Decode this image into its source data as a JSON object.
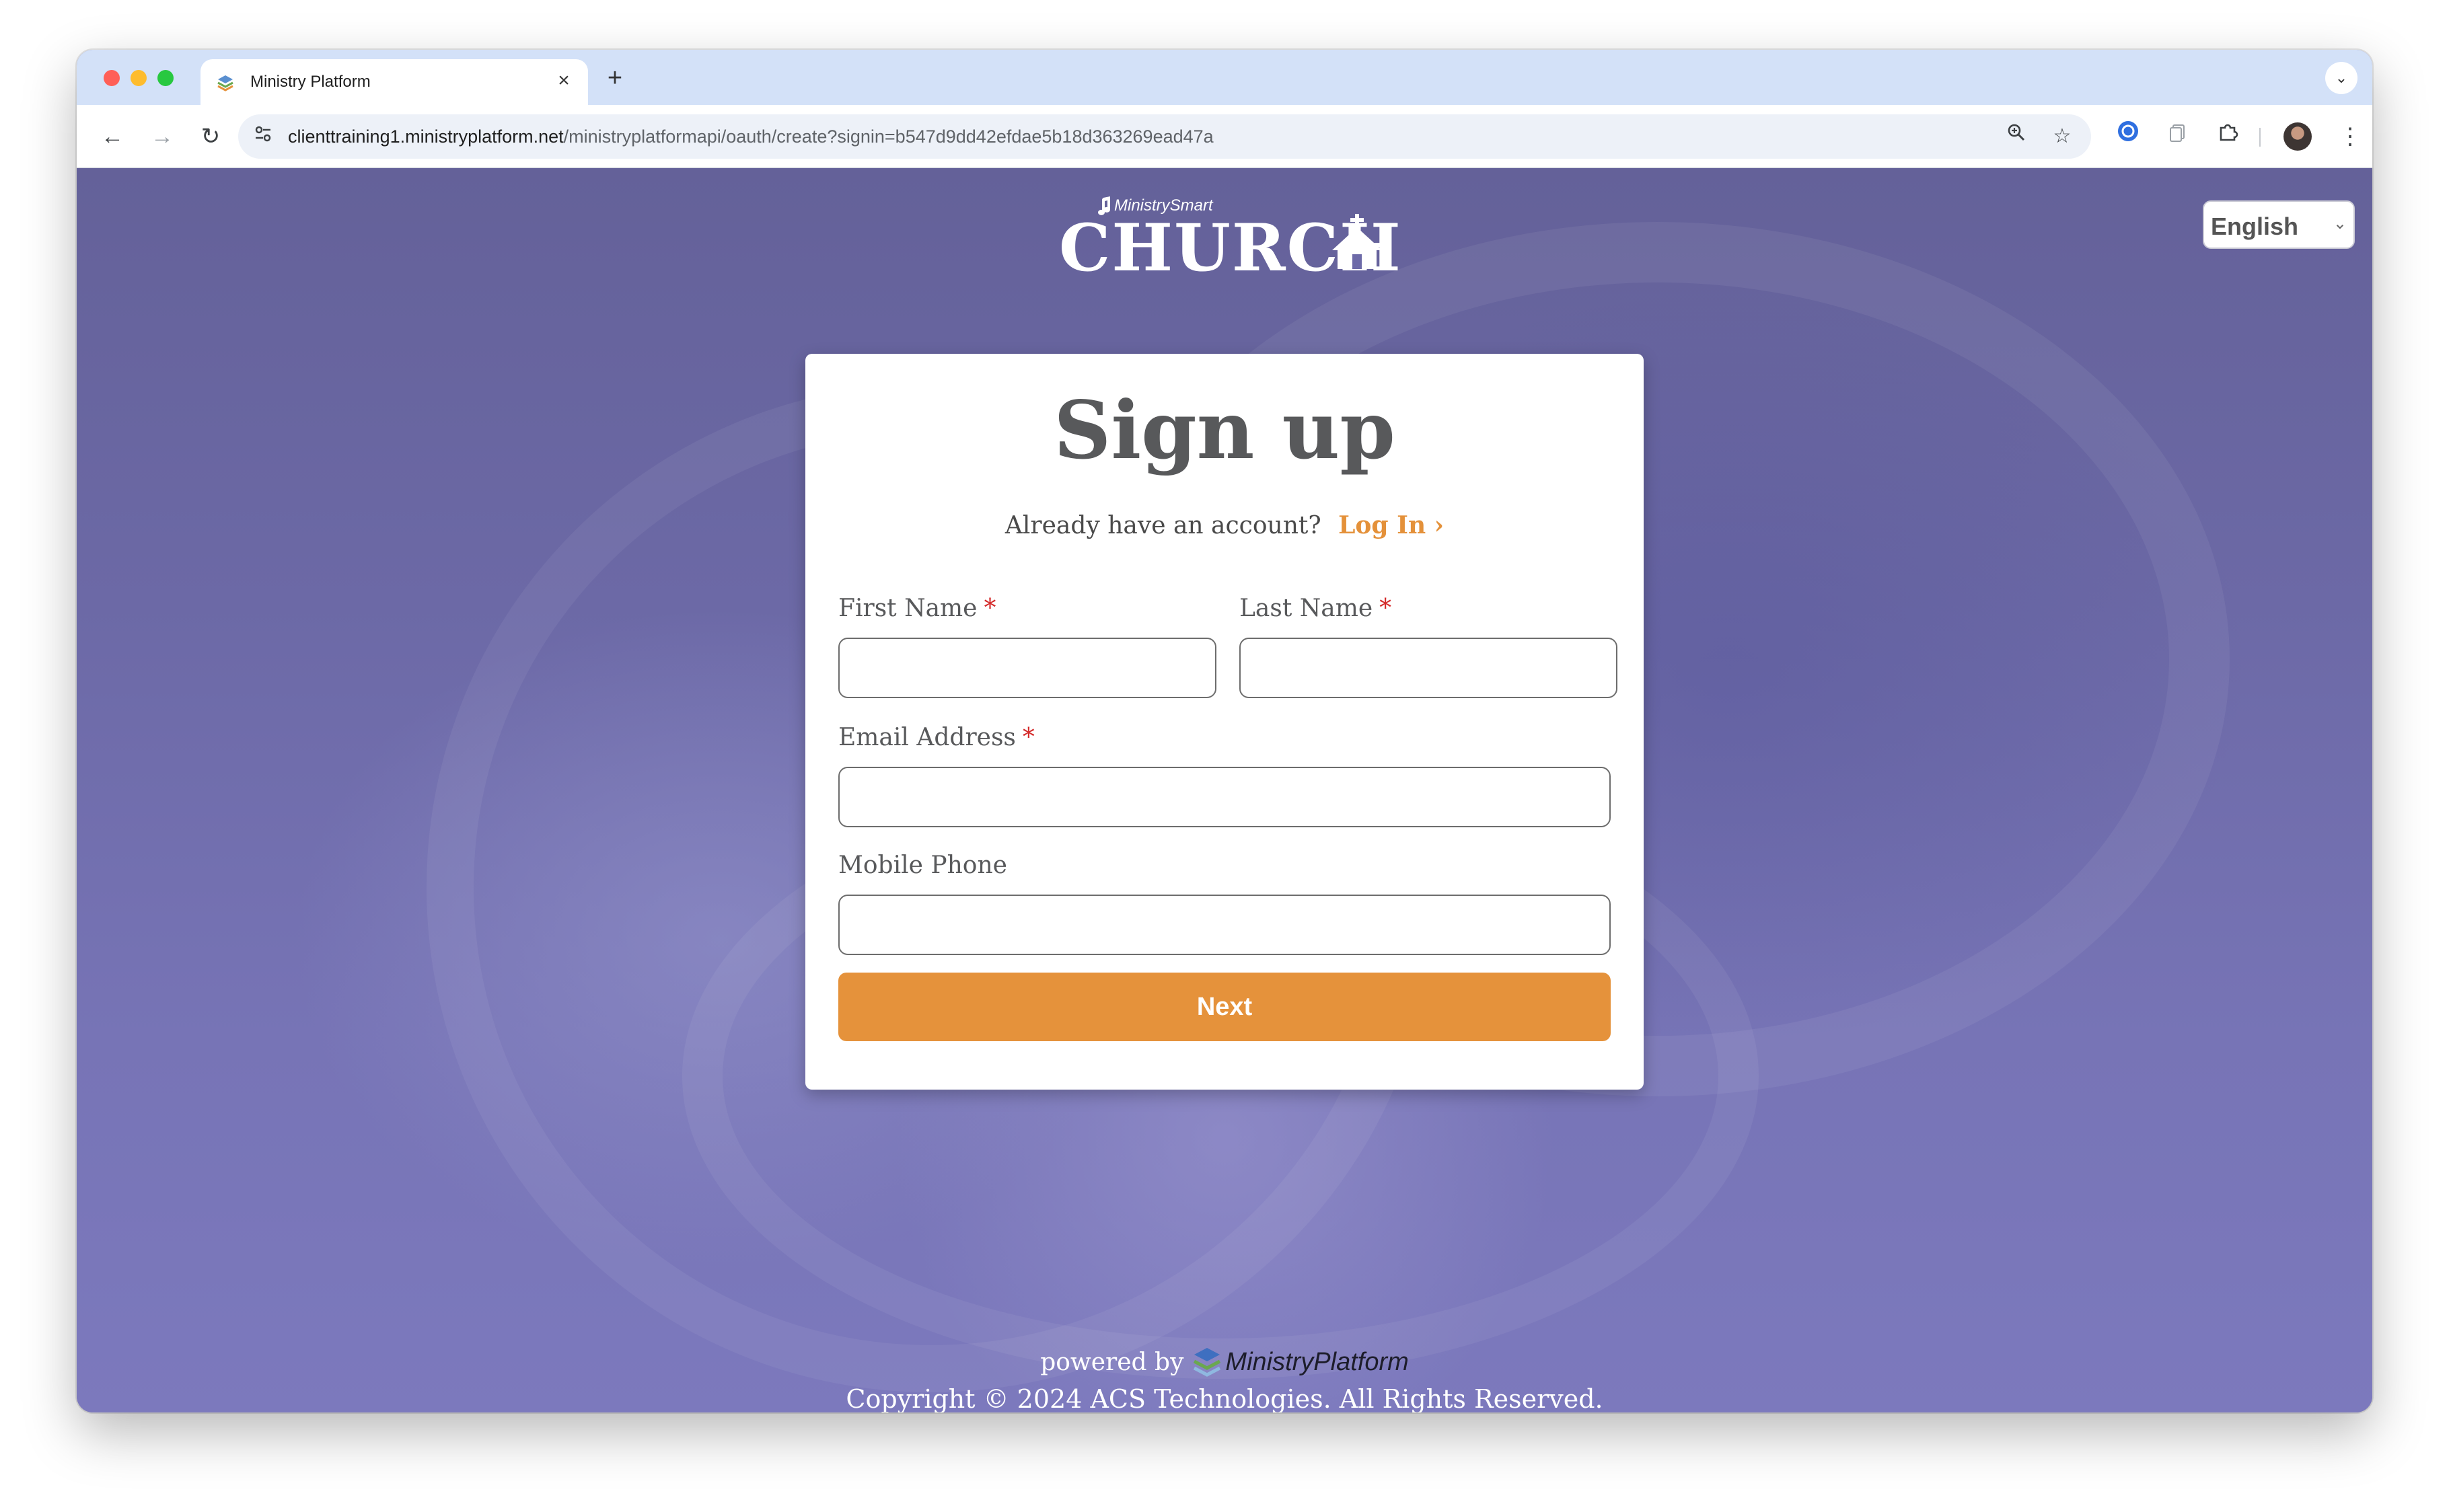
{
  "browser": {
    "tab_title": "Ministry Platform",
    "tab_close": "×",
    "new_tab": "+",
    "tab_search": "⌄",
    "url_host": "clienttraining1.ministryplatform.net",
    "url_path": "/ministryplatformapi/oauth/create?signin=b547d9dd42efdae5b18d363269ead47a",
    "back": "←",
    "forward": "→",
    "reload": "↻",
    "menu": "⋮"
  },
  "logo": {
    "small": "MinistrySmart",
    "big": "CHURCH"
  },
  "language": {
    "selected": "English"
  },
  "signup": {
    "title": "Sign up",
    "already_text": "Already have an account?",
    "login_link": "Log In ›",
    "required_marker": "*",
    "first_name_label": "First Name",
    "last_name_label": "Last Name",
    "email_label": "Email Address",
    "mobile_label": "Mobile Phone",
    "first_name_value": "",
    "last_name_value": "",
    "email_value": "",
    "mobile_value": "",
    "next_button": "Next"
  },
  "footer": {
    "powered_by": "powered by",
    "brand": "MinistryPlatform",
    "copyright": "Copyright © 2024 ACS Technologies. All Rights Reserved."
  },
  "colors": {
    "accent": "#e5923b",
    "background": "#6d6aa8",
    "required": "#d42b2b"
  }
}
